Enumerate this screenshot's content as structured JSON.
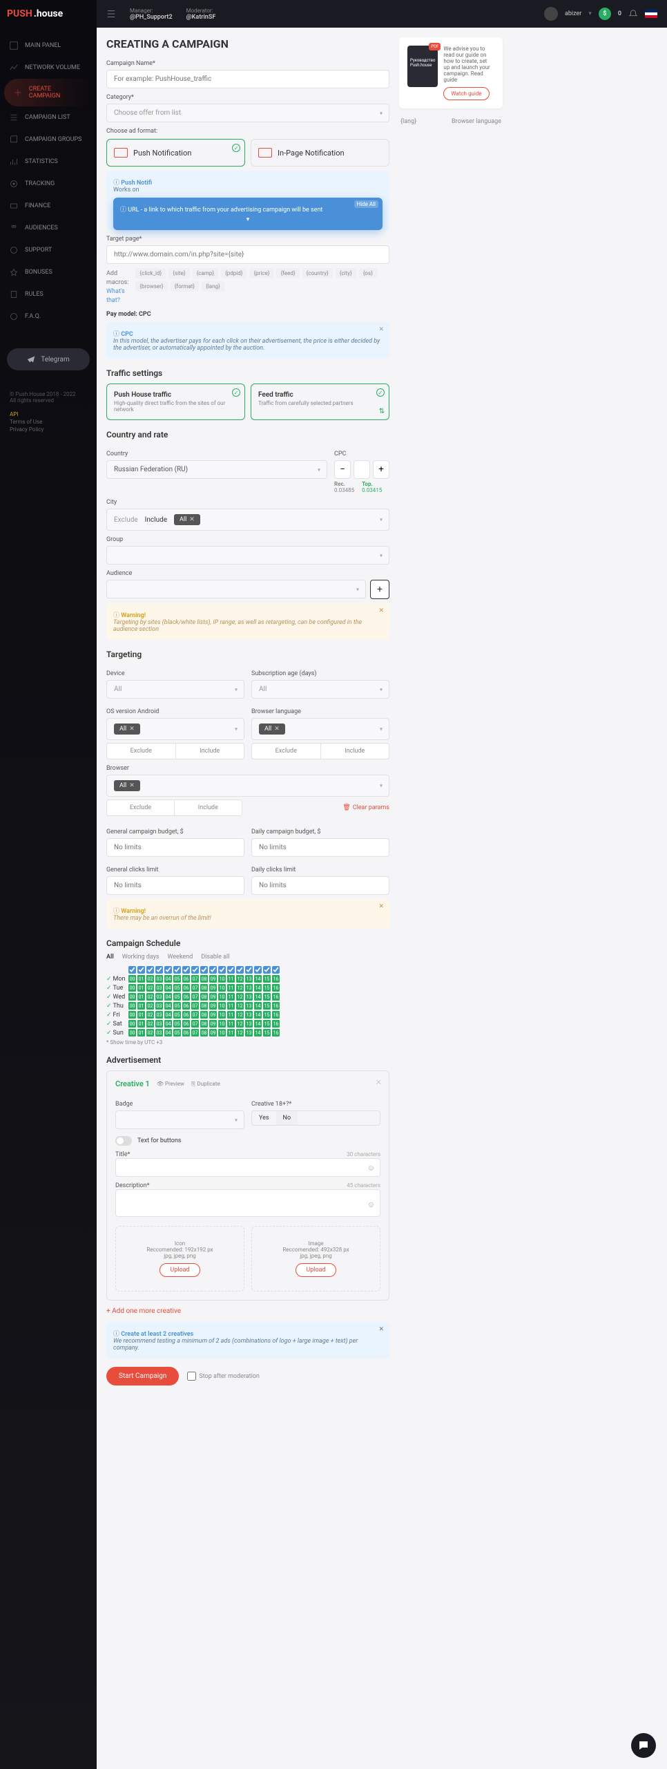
{
  "logo": {
    "p1": "PUSH",
    "p2": ".house"
  },
  "topbar": {
    "manager_label": "Manager:",
    "manager": "@PH_Support2",
    "moderator_label": "Moderator:",
    "moderator": "@KatrinSF",
    "username": "abizer",
    "balance": "0"
  },
  "nav": [
    {
      "label": "MAIN PANEL"
    },
    {
      "label": "NETWORK VOLUME"
    },
    {
      "label": "CREATE CAMPAIGN",
      "active": true
    },
    {
      "label": "CAMPAIGN LIST"
    },
    {
      "label": "CAMPAIGN GROUPS"
    },
    {
      "label": "STATISTICS"
    },
    {
      "label": "TRACKING"
    },
    {
      "label": "FINANCE"
    },
    {
      "label": "AUDIENCES"
    },
    {
      "label": "SUPPORT"
    },
    {
      "label": "BONUSES"
    },
    {
      "label": "RULES"
    },
    {
      "label": "F.A.Q."
    }
  ],
  "telegram": "Telegram",
  "footer": {
    "copyright": "© Push.House 2018 - 2022",
    "rights": "All rights reserved",
    "api": "API",
    "terms": "Terms of Use",
    "privacy": "Privacy Policy"
  },
  "page_title": "CREATING A CAMPAIGN",
  "fields": {
    "name_label": "Campaign Name*",
    "name_placeholder": "For example: PushHouse_traffic",
    "category_label": "Category*",
    "category_placeholder": "Choose offer from list",
    "adformat_label": "Choose ad format:",
    "target_label": "Target page*",
    "target_placeholder": "http://www.domain.com/in.php?site={site}",
    "macros_label": "Add macros:",
    "macros_link": "What's that?",
    "paymodel": "Pay model: CPC",
    "country_label": "Country",
    "country_value": "Russian Federation (RU)",
    "cpc_label": "CPC",
    "city_label": "City",
    "group_label": "Group",
    "audience_label": "Audience",
    "device_label": "Device",
    "subage_label": "Subscription age (days)",
    "osver_label": "OS version Android",
    "browserlang_label": "Browser language",
    "browser_label": "Browser",
    "gen_budget_label": "General campaign budget, $",
    "daily_budget_label": "Daily campaign budget, $",
    "gen_clicks_label": "General clicks limit",
    "daily_clicks_label": "Daily clicks limit",
    "nolimits": "No limits",
    "all": "All",
    "exclude": "Exclude",
    "include": "Include"
  },
  "ad_formats": {
    "push": "Push Notification",
    "inpage": "In-Page Notification"
  },
  "push_info": {
    "title": "Push Notifi",
    "desc": "Works on"
  },
  "tooltip": {
    "text": "URL - a link to which traffic from your advertising campaign will be sent",
    "hide": "Hide All"
  },
  "macros": [
    "{click_id}",
    "{site}",
    "{camp}",
    "{pdpid}",
    "{price}",
    "{feed}",
    "{country}",
    "{city}",
    "{os}",
    "{browser}",
    "{format}",
    "{lang}"
  ],
  "cpc_info": {
    "title": "CPC",
    "desc": "In this model, the advertiser pays for each click on their advertisement, the price is either decided by the advertiser, or automatically appointed by the auction."
  },
  "sections": {
    "traffic": "Traffic settings",
    "country": "Country and rate",
    "targeting": "Targeting",
    "schedule": "Campaign Schedule",
    "advertisement": "Advertisement"
  },
  "traffic": {
    "push_title": "Push House traffic",
    "push_desc": "High-quality direct traffic from the sites of our network",
    "feed_title": "Feed traffic",
    "feed_desc": "Traffic from carefully selected partners"
  },
  "cpc_hints": {
    "rec_label": "Rec.",
    "rec": "0.03485",
    "top_label": "Top.",
    "top": "0.03415"
  },
  "warning1": {
    "title": "Warning!",
    "desc": "Targeting by sites (black/white lists), IP range, as well as retargeting, can be configured in the audience section"
  },
  "clear_params": "Clear params",
  "warning2": {
    "title": "Warning!",
    "desc": "There may be an overrun of the limit!"
  },
  "schedule": {
    "tabs": [
      "All",
      "Working days",
      "Weekend",
      "Disable all"
    ],
    "days": [
      "Mon",
      "Tue",
      "Wed",
      "Thu",
      "Fri",
      "Sat",
      "Sun"
    ],
    "note": "* Show time by UTC +3"
  },
  "creative": {
    "title": "Creative 1",
    "preview": "Preview",
    "duplicate": "Duplicate",
    "badge_label": "Badge",
    "c18_label": "Creative 18+?*",
    "yes": "Yes",
    "no": "No",
    "textbtn": "Text for buttons",
    "title_label": "Title*",
    "title_chars": "30 characters",
    "desc_label": "Description*",
    "desc_chars": "45 characters",
    "icon_title": "Icon",
    "icon_rec": "Reccomended: 192x192 px",
    "icon_fmt": "jpg, jpeg, png",
    "img_title": "Image",
    "img_rec": "Reccomended: 492x328 px",
    "img_fmt": "jpg, jpeg, png",
    "upload": "Upload",
    "add_more": "+ Add one more creative"
  },
  "create_info": {
    "title": "Create at least 2 creatives",
    "desc": "We recommend testing a minimum of 2 ads (combinations of logo + large image + text) per company."
  },
  "submit": {
    "start": "Start Campaign",
    "stop": "Stop after moderation"
  },
  "guide": {
    "text": "We advise you to read our guide on how to create, set up and launch your campaign. Read guide",
    "btn": "Watch guide",
    "pdf": "PDF",
    "booklet": "Руководство Push.house"
  },
  "lang_row": {
    "code": "{lang}",
    "name": "Browser language"
  }
}
